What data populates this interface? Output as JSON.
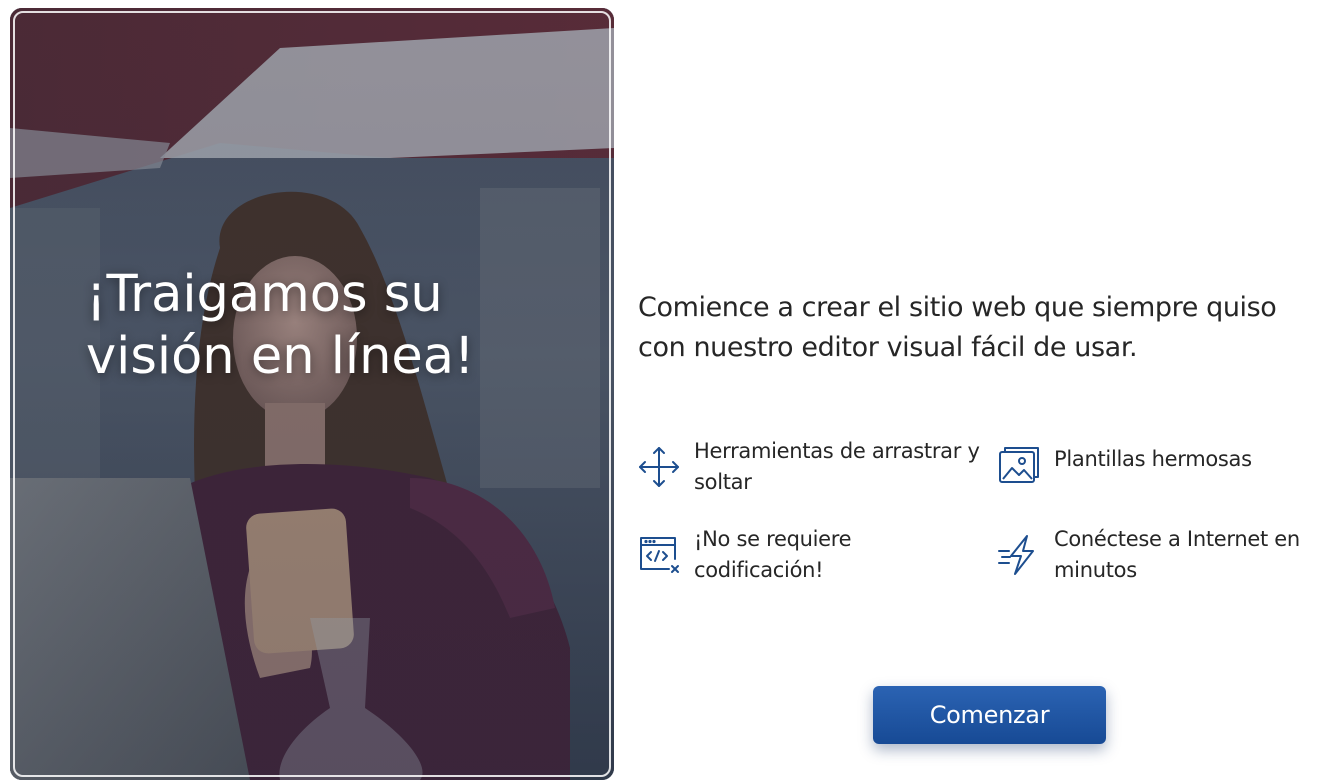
{
  "hero": {
    "title_line1": "¡Traigamos su",
    "title_line2": "visión en línea!"
  },
  "intro": {
    "text": "Comience a crear el sitio web que siempre quiso con nuestro editor visual fácil de usar."
  },
  "features": [
    {
      "icon": "move-arrows-icon",
      "label": "Herramientas de arrastrar y soltar"
    },
    {
      "icon": "image-gallery-icon",
      "label": "Plantillas hermosas"
    },
    {
      "icon": "code-window-icon",
      "label": "¡No se requiere codificación!"
    },
    {
      "icon": "lightning-icon",
      "label": "Conéctese a Internet en minutos"
    }
  ],
  "cta": {
    "label": "Comenzar"
  },
  "colors": {
    "accent": "#1f55a3",
    "icon": "#1d4e8f",
    "text": "#262626"
  }
}
